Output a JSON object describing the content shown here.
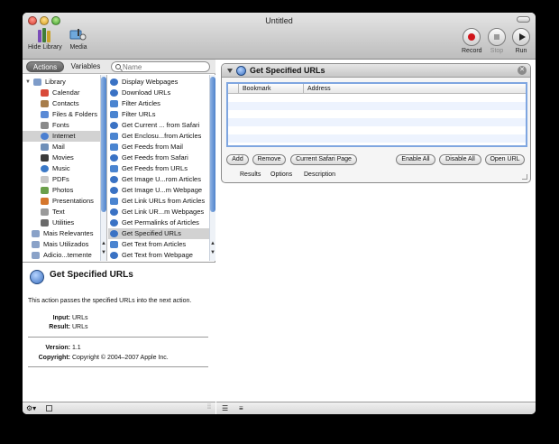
{
  "window": {
    "title": "Untitled"
  },
  "toolbar": {
    "hide_library_label": "Hide Library",
    "media_label": "Media",
    "record_label": "Record",
    "stop_label": "Stop",
    "run_label": "Run"
  },
  "library": {
    "segments": {
      "actions": "Actions",
      "variables": "Variables"
    },
    "search_placeholder": "Name",
    "categories": [
      {
        "label": "Library",
        "icon": "library-folder-icon"
      },
      {
        "label": "Calendar",
        "icon": "calendar-icon"
      },
      {
        "label": "Contacts",
        "icon": "contacts-icon"
      },
      {
        "label": "Files & Folders",
        "icon": "finder-icon"
      },
      {
        "label": "Fonts",
        "icon": "fonts-icon"
      },
      {
        "label": "Internet",
        "icon": "internet-icon",
        "selected": true
      },
      {
        "label": "Mail",
        "icon": "mail-icon"
      },
      {
        "label": "Movies",
        "icon": "movies-icon"
      },
      {
        "label": "Music",
        "icon": "music-icon"
      },
      {
        "label": "PDFs",
        "icon": "pdf-icon"
      },
      {
        "label": "Photos",
        "icon": "photos-icon"
      },
      {
        "label": "Presentations",
        "icon": "presentations-icon"
      },
      {
        "label": "Text",
        "icon": "text-icon"
      },
      {
        "label": "Utilities",
        "icon": "utilities-icon"
      },
      {
        "label": "Mais Relevantes",
        "icon": "smart-folder-icon"
      },
      {
        "label": "Mais Utilizados",
        "icon": "smart-folder-icon"
      },
      {
        "label": "Adicio...temente",
        "icon": "smart-folder-icon"
      }
    ],
    "actions": [
      {
        "label": "Display Webpages",
        "icon": "safari-icon"
      },
      {
        "label": "Download URLs",
        "icon": "safari-icon"
      },
      {
        "label": "Filter Articles",
        "icon": "rss-icon"
      },
      {
        "label": "Filter URLs",
        "icon": "rss-icon"
      },
      {
        "label": "Get Current ... from Safari",
        "icon": "safari-icon"
      },
      {
        "label": "Get Enclosu...from Articles",
        "icon": "rss-icon"
      },
      {
        "label": "Get Feeds from Mail",
        "icon": "rss-icon"
      },
      {
        "label": "Get Feeds from Safari",
        "icon": "safari-icon"
      },
      {
        "label": "Get Feeds from URLs",
        "icon": "rss-icon"
      },
      {
        "label": "Get Image U...rom Articles",
        "icon": "safari-icon"
      },
      {
        "label": "Get Image U...m Webpage",
        "icon": "safari-icon"
      },
      {
        "label": "Get Link URLs from Articles",
        "icon": "rss-icon"
      },
      {
        "label": "Get Link UR...m Webpages",
        "icon": "safari-icon"
      },
      {
        "label": "Get Permalinks of Articles",
        "icon": "safari-icon"
      },
      {
        "label": "Get Specified URLs",
        "icon": "safari-icon",
        "selected": true
      },
      {
        "label": "Get Text from Articles",
        "icon": "rss-icon"
      },
      {
        "label": "Get Text from Webpage",
        "icon": "safari-icon"
      }
    ]
  },
  "description": {
    "title": "Get Specified URLs",
    "text": "This action passes the specified URLs into the next action.",
    "input_label": "Input:",
    "input_value": "URLs",
    "result_label": "Result:",
    "result_value": "URLs",
    "version_label": "Version:",
    "version_value": "1.1",
    "copyright_label": "Copyright:",
    "copyright_value": "Copyright © 2004–2007 Apple Inc."
  },
  "workflow_action": {
    "title": "Get Specified URLs",
    "columns": [
      "Bookmark",
      "Address"
    ],
    "buttons": {
      "add": "Add",
      "remove": "Remove",
      "current_safari_page": "Current Safari Page",
      "enable_all": "Enable All",
      "disable_all": "Disable All",
      "open_url": "Open URL"
    },
    "tabs": [
      "Results",
      "Options",
      "Description"
    ]
  }
}
